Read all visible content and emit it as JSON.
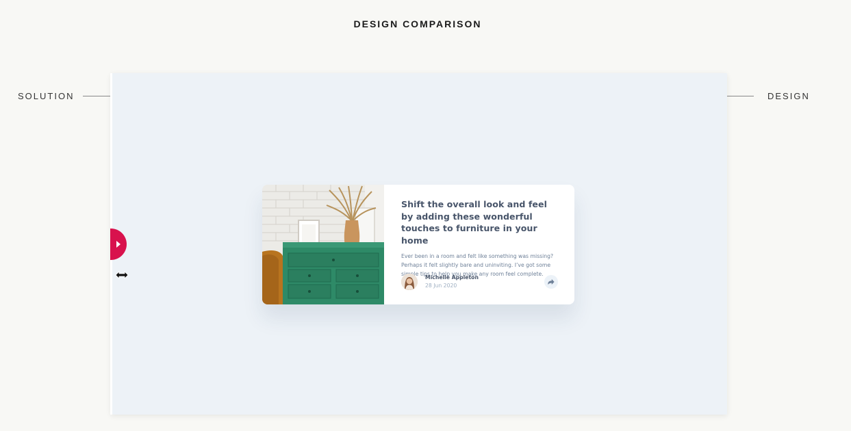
{
  "page": {
    "heading": "DESIGN COMPARISON",
    "solution_label": "SOLUTION",
    "design_label": "DESIGN"
  },
  "slider": {
    "handle_icon": "caret-right-icon",
    "cursor_icon": "resize-horizontal-cursor-icon",
    "accent_color": "#d8124d"
  },
  "card": {
    "image_alt": "furniture",
    "title": "Shift the overall look and feel by adding these wonderful touches to furniture in your home",
    "description": "Ever been in a room and felt like something was missing? Perhaps it felt slightly bare and uninviting. I’ve got some simple tips to help you make any room feel complete.",
    "author": {
      "name": "Michelle Appleton",
      "date": "28 Jun 2020"
    },
    "share_icon": "share-icon"
  },
  "colors": {
    "background": "#f8f8f5",
    "frame_background": "#edf2f7",
    "card_title": "#48556a",
    "card_text": "#6e8098"
  }
}
